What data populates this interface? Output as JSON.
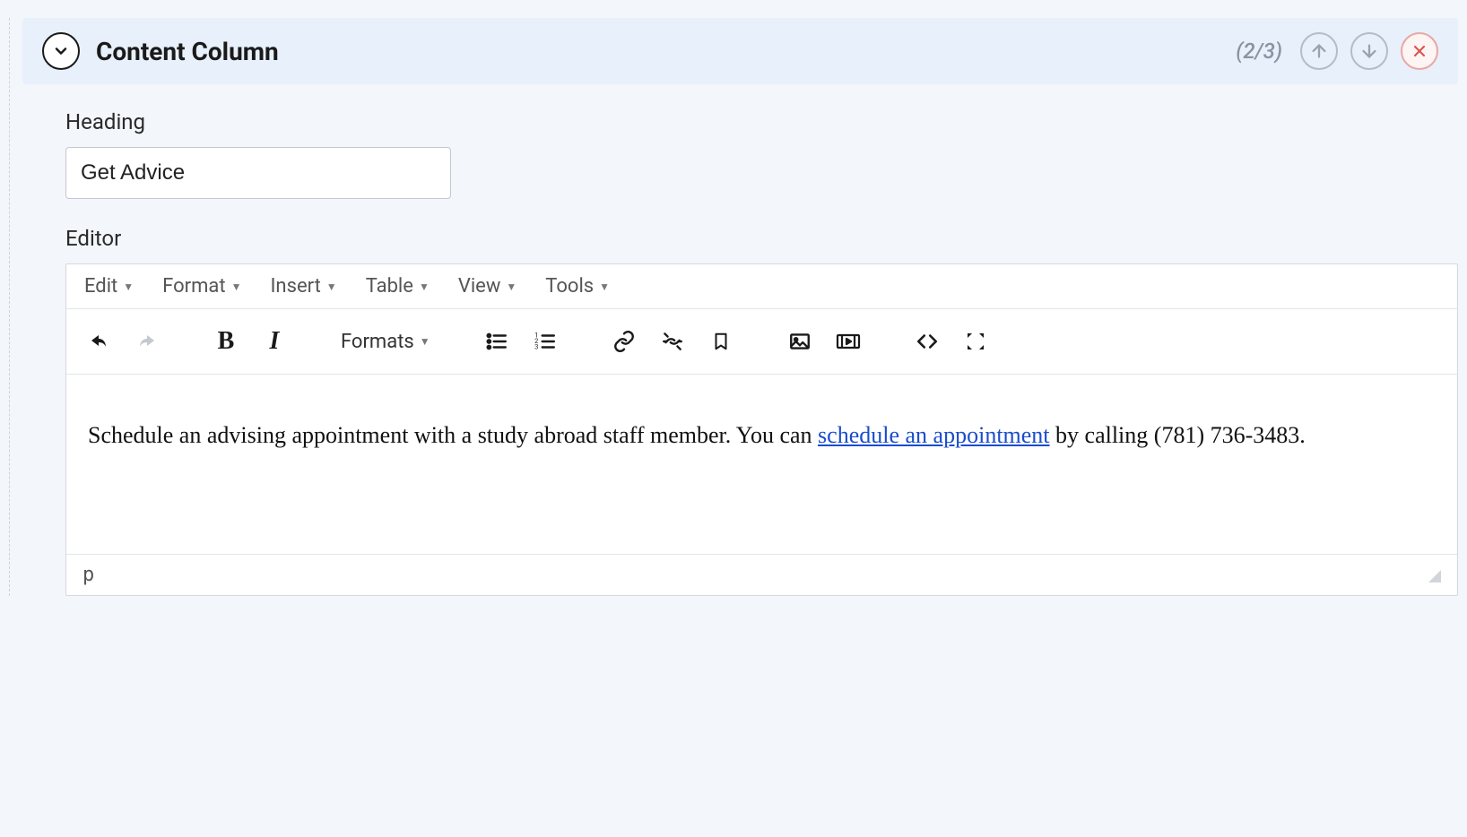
{
  "panel": {
    "title": "Content Column",
    "counter": "(2/3)"
  },
  "fields": {
    "heading_label": "Heading",
    "heading_value": "Get Advice",
    "editor_label": "Editor"
  },
  "editor": {
    "menus": {
      "edit": "Edit",
      "format": "Format",
      "insert": "Insert",
      "table": "Table",
      "view": "View",
      "tools": "Tools"
    },
    "toolbar": {
      "formats_label": "Formats"
    },
    "content": {
      "prefix": "Schedule an advising appointment with a study abroad staff member. You can ",
      "link_text": "schedule an appointment",
      "suffix": " by calling (781) 736-3483."
    },
    "status_path": "p"
  }
}
